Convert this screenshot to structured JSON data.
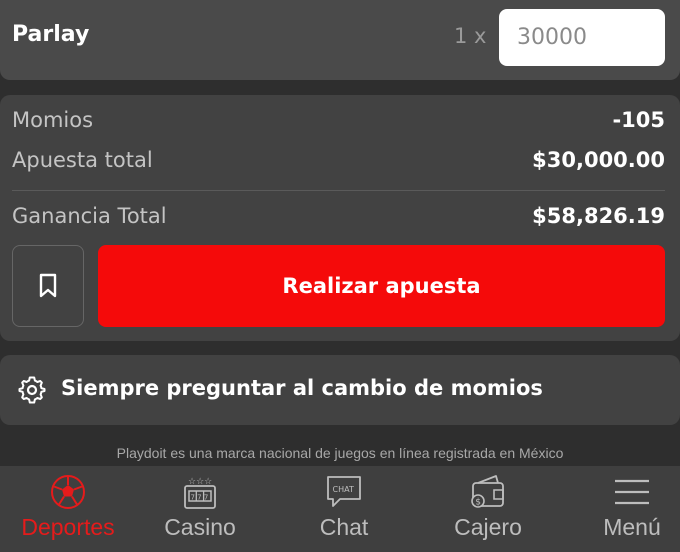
{
  "parlay": {
    "title": "Parlay",
    "multiplier": "1 x",
    "stake_value": "30000"
  },
  "summary": {
    "odds_label": "Momios",
    "odds_value": "-105",
    "total_bet_label": "Apuesta total",
    "total_bet_value": "$30,000.00",
    "total_win_label": "Ganancia Total",
    "total_win_value": "$58,826.19",
    "place_bet_label": "Realizar apuesta"
  },
  "settings": {
    "odds_change_label": "Siempre preguntar al cambio de momios"
  },
  "footer": {
    "legal_text": "Playdoit es una marca nacional de juegos en línea registrada en México"
  },
  "nav": {
    "items": [
      {
        "label": "Deportes",
        "icon": "soccer-ball-icon",
        "active": true
      },
      {
        "label": "Casino",
        "icon": "slot-machine-icon",
        "active": false
      },
      {
        "label": "Chat",
        "icon": "chat-bubble-icon",
        "active": false
      },
      {
        "label": "Cajero",
        "icon": "wallet-icon",
        "active": false
      },
      {
        "label": "Menú",
        "icon": "hamburger-icon",
        "active": false
      }
    ]
  },
  "colors": {
    "accent": "#f50a0a",
    "active_nav": "#e51b1b",
    "card": "#424242",
    "background": "#2e2e2e"
  }
}
